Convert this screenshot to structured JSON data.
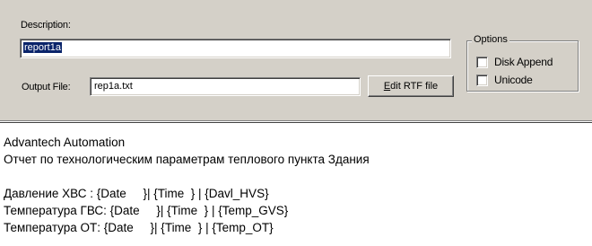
{
  "form": {
    "description_label": "Description:",
    "description_value": "report1a",
    "output_file_label": "Output File:",
    "output_file_value": "rep1a.txt",
    "edit_rtf_button": {
      "mnemonic": "E",
      "rest": "dit RTF file"
    }
  },
  "options": {
    "title": "Options",
    "disk_append_label": "Disk Append",
    "disk_append_checked": false,
    "unicode_label": "Unicode",
    "unicode_checked": false
  },
  "editor": {
    "lines": [
      "Advantech Automation",
      "Отчет по технологическим параметрам теплового пункта Здания",
      "",
      "Давление ХВС : {Date     }| {Time  } | {Davl_HVS}",
      "Температура ГВС: {Date     }| {Time  } | {Temp_GVS}",
      "Температура ОТ: {Date     }| {Time  } | {Temp_OT}"
    ]
  }
}
